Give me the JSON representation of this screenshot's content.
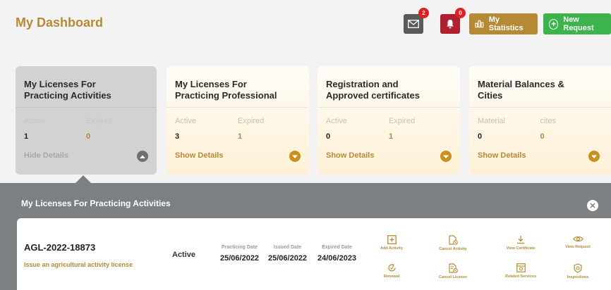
{
  "header": {
    "title": "My Dashboard",
    "mail_badge": "2",
    "bell_badge": "0",
    "stats_label": "My Statistics",
    "new_request_label": "New Request"
  },
  "cards": [
    {
      "title_line1": "My Licenses For",
      "title_line2": "Practicing Activities",
      "label1": "Active",
      "label2": "Expired",
      "value1": "1",
      "value2": "0",
      "details": "Hide Details"
    },
    {
      "title_line1": "My Licenses For",
      "title_line2": "Practicing Professional",
      "label1": "Active",
      "label2": "Expired",
      "value1": "3",
      "value2": "1",
      "details": "Show Details"
    },
    {
      "title_line1": "Registration and",
      "title_line2": "Approved certificates",
      "label1": "Active",
      "label2": "Expired",
      "value1": "0",
      "value2": "1",
      "details": "Show Details"
    },
    {
      "title_line1": "Material Balances &",
      "title_line2": "Cities",
      "label1": "Material",
      "label2": "cites",
      "value1": "0",
      "value2": "0",
      "details": "Show Details"
    }
  ],
  "panel": {
    "title": "My Licenses For Practicing Activities",
    "license": {
      "number": "AGL-2022-18873",
      "description": "Issue an agricultural activity license",
      "status": "Active",
      "practicing_label": "Practicing Date",
      "practicing_value": "25/06/2022",
      "issued_label": "Issued Date",
      "issued_value": "25/06/2022",
      "expired_label": "Expired Date",
      "expired_value": "24/06/2023"
    },
    "actions": [
      {
        "label": "Add Activity",
        "icon": "add-activity-icon"
      },
      {
        "label": "Cancel Activity",
        "icon": "cancel-activity-icon"
      },
      {
        "label": "View Certificate",
        "icon": "download-icon"
      },
      {
        "label": "View Request",
        "icon": "eye-icon"
      },
      {
        "label": "Renewal",
        "icon": "renew-icon"
      },
      {
        "label": "Cancel License",
        "icon": "cancel-license-icon"
      },
      {
        "label": "Related Services",
        "icon": "related-services-icon"
      },
      {
        "label": "Inspections",
        "icon": "inspection-icon"
      }
    ]
  },
  "colors": {
    "gold": "#b68a35",
    "panel_gray": "#7c8083",
    "green": "#3cb44b",
    "bell_red": "#b0212f"
  }
}
